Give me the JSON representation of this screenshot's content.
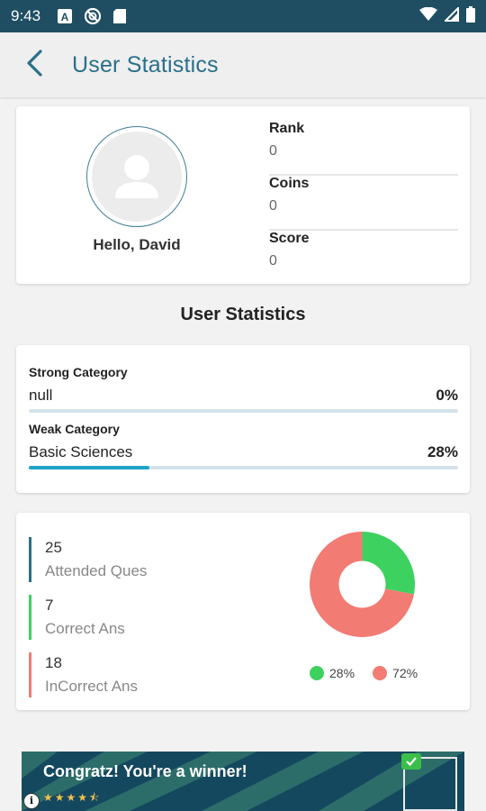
{
  "status_bar": {
    "time": "9:43",
    "left_icons": [
      "notification-a-icon",
      "blocked-circle-icon",
      "sd-card-icon"
    ],
    "right_icons": [
      "wifi-icon",
      "signal-icon",
      "battery-icon"
    ]
  },
  "app_bar": {
    "title": "User Statistics",
    "back_icon": "back-arrow-icon"
  },
  "profile": {
    "greeting": "Hello, David",
    "stats": [
      {
        "label": "Rank",
        "value": "0"
      },
      {
        "label": "Coins",
        "value": "0"
      },
      {
        "label": "Score",
        "value": "0"
      }
    ]
  },
  "section_title": "User Statistics",
  "categories": {
    "strong": {
      "label": "Strong Category",
      "name": "null",
      "percent_text": "0%",
      "percent": 0
    },
    "weak": {
      "label": "Weak Category",
      "name": "Basic Sciences",
      "percent_text": "28%",
      "percent": 28
    }
  },
  "answers": {
    "items": [
      {
        "value": "25",
        "label": "Attended Ques",
        "color": "#2a6f8a"
      },
      {
        "value": "7",
        "label": "Correct Ans",
        "color": "#3dd15f"
      },
      {
        "value": "18",
        "label": "InCorrect Ans",
        "color": "#f27b74"
      }
    ],
    "donut": {
      "slices": [
        {
          "percent": 28,
          "color": "#3dd15f",
          "label": "28%"
        },
        {
          "percent": 72,
          "color": "#f27b74",
          "label": "72%"
        }
      ]
    }
  },
  "ad": {
    "message": "Congratz! You're a winner!",
    "stars": "★★★★⯪",
    "rating": 4.5
  },
  "colors": {
    "status_bar": "#1f4e63",
    "accent": "#2a6f8a",
    "bar_fill": "#1fa3c7"
  }
}
